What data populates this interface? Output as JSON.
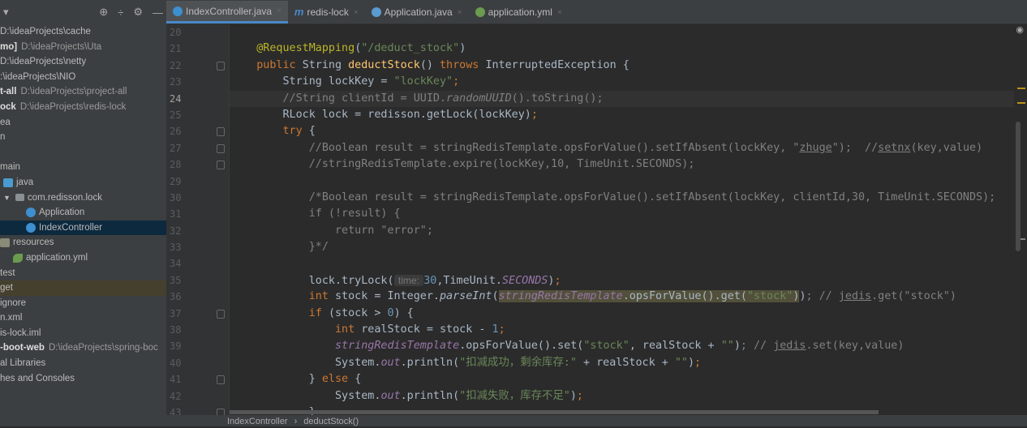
{
  "sidebar": {
    "header_icons": [
      "target-icon",
      "collapse-icon",
      "gear-icon",
      "minimize-icon"
    ],
    "items": [
      {
        "bold": "",
        "path": "D:\\ideaProjects\\cache",
        "icon": ""
      },
      {
        "bold": "mo]",
        "path": "D:\\ideaProjects\\Uta",
        "icon": ""
      },
      {
        "bold": "",
        "path": "D:\\ideaProjects\\netty",
        "icon": ""
      },
      {
        "bold": "",
        "path": ":\\ideaProjects\\NIO",
        "icon": ""
      },
      {
        "bold": "t-all",
        "path": "D:\\ideaProjects\\project-all",
        "icon": ""
      },
      {
        "bold": "ock",
        "path": "D:\\ideaProjects\\redis-lock",
        "icon": ""
      },
      {
        "bold": "",
        "path": "ea",
        "icon": ""
      },
      {
        "bold": "",
        "path": "n",
        "icon": ""
      },
      {
        "bold": "",
        "path": "",
        "icon": ""
      },
      {
        "bold": "",
        "path": "main",
        "icon": ""
      },
      {
        "bold": "",
        "path": "java",
        "icon": "folder",
        "indent": 4
      },
      {
        "bold": "",
        "path": "com.redisson.lock",
        "icon": "pkg",
        "indent": 4,
        "arrow": "▼"
      },
      {
        "bold": "",
        "path": "Application",
        "icon": "cls",
        "indent": 32
      },
      {
        "bold": "",
        "path": "IndexController",
        "icon": "cls",
        "indent": 32,
        "selected": true
      },
      {
        "bold": "",
        "path": "resources",
        "icon": "res",
        "indent": 0
      },
      {
        "bold": "",
        "path": "application.yml",
        "icon": "yml",
        "indent": 16
      },
      {
        "bold": "",
        "path": "test",
        "icon": ""
      },
      {
        "bold": "",
        "path": "get",
        "icon": "",
        "highlight": true
      },
      {
        "bold": "",
        "path": "ignore",
        "icon": ""
      },
      {
        "bold": "",
        "path": "n.xml",
        "icon": ""
      },
      {
        "bold": "",
        "path": "is-lock.iml",
        "icon": ""
      },
      {
        "bold": "-boot-web",
        "path": "D:\\ideaProjects\\spring-boc",
        "icon": ""
      },
      {
        "bold": "",
        "path": "al Libraries",
        "icon": ""
      },
      {
        "bold": "",
        "path": "hes and Consoles",
        "icon": ""
      }
    ]
  },
  "tabs": [
    {
      "label": "IndexController.java",
      "icon": "class-icon",
      "active": true
    },
    {
      "label": "redis-lock",
      "icon": "maven-icon"
    },
    {
      "label": "Application.java",
      "icon": "spring-boot-icon"
    },
    {
      "label": "application.yml",
      "icon": "yml-icon"
    }
  ],
  "editor": {
    "current_line": 24,
    "lines": [
      {
        "n": "20",
        "t": []
      },
      {
        "n": "21",
        "t": [
          [
            "    ",
            ""
          ],
          [
            "@RequestMapping",
            "ann"
          ],
          [
            "(",
            ""
          ],
          [
            "\"/deduct_stock\"",
            "str"
          ],
          [
            ")",
            ""
          ]
        ]
      },
      {
        "n": "22",
        "fold": true,
        "t": [
          [
            "    ",
            ""
          ],
          [
            "public ",
            "kw"
          ],
          [
            "String ",
            ""
          ],
          [
            "deductStock",
            "fn"
          ],
          [
            "() ",
            ""
          ],
          [
            "throws ",
            "kw"
          ],
          [
            "InterruptedException {",
            ""
          ]
        ]
      },
      {
        "n": "23",
        "t": [
          [
            "        String lockKey = ",
            ""
          ],
          [
            "\"lockKey\"",
            "str"
          ],
          [
            ";",
            "kw"
          ]
        ]
      },
      {
        "n": "24",
        "t": [
          [
            "        ",
            ""
          ],
          [
            "//String clientId = UUID.",
            "cm"
          ],
          [
            "randomUUID",
            "cm it"
          ],
          [
            "().toString();",
            "cm"
          ]
        ]
      },
      {
        "n": "25",
        "t": [
          [
            "        RLock lock = redisson.getLock(lockKey)",
            ""
          ],
          [
            ";",
            "kw"
          ]
        ]
      },
      {
        "n": "26",
        "fold": true,
        "t": [
          [
            "        ",
            ""
          ],
          [
            "try ",
            "kw"
          ],
          [
            "{",
            ""
          ]
        ]
      },
      {
        "n": "27",
        "fold": true,
        "t": [
          [
            "            ",
            ""
          ],
          [
            "//Boolean result = stringRedisTemplate.opsForValue().setIfAbsent(lockKey, \"",
            "cm"
          ],
          [
            "zhuge",
            "cm ul"
          ],
          [
            "\");  //",
            "cm"
          ],
          [
            "setnx",
            "cm ul"
          ],
          [
            "(key,value)",
            "cm"
          ]
        ]
      },
      {
        "n": "28",
        "fold": true,
        "t": [
          [
            "            ",
            ""
          ],
          [
            "//stringRedisTemplate.expire(lockKey,10, TimeUnit.SECONDS);",
            "cm"
          ]
        ]
      },
      {
        "n": "29",
        "t": []
      },
      {
        "n": "30",
        "t": [
          [
            "            ",
            ""
          ],
          [
            "/*Boolean result = stringRedisTemplate.opsForValue().setIfAbsent(lockKey, clientId,30, TimeUnit.SECONDS);",
            "cm"
          ]
        ]
      },
      {
        "n": "31",
        "t": [
          [
            "            ",
            ""
          ],
          [
            "if (!result) {",
            "cm"
          ]
        ]
      },
      {
        "n": "32",
        "t": [
          [
            "                ",
            ""
          ],
          [
            "return \"error\";",
            "cm"
          ]
        ]
      },
      {
        "n": "33",
        "t": [
          [
            "            ",
            ""
          ],
          [
            "}*/",
            "cm"
          ]
        ]
      },
      {
        "n": "34",
        "t": []
      },
      {
        "n": "35",
        "t": [
          [
            "            lock.tryLock(",
            ""
          ],
          [
            " time: ",
            "hint"
          ],
          [
            "30",
            "num"
          ],
          [
            ",TimeUnit.",
            ""
          ],
          [
            "SECONDS",
            "fld"
          ],
          [
            ")",
            ""
          ],
          [
            ";",
            "kw"
          ]
        ]
      },
      {
        "n": "36",
        "t": [
          [
            "            ",
            ""
          ],
          [
            "int ",
            "kw"
          ],
          [
            "stock = Integer.",
            ""
          ],
          [
            "parseInt",
            "it"
          ],
          [
            "(",
            ""
          ],
          [
            "stringRedisTemplate",
            "fld hlbg"
          ],
          [
            ".opsForValue().get(",
            "hlbg"
          ],
          [
            "\"stock\"",
            "str hlbg"
          ],
          [
            ")",
            "hlbg"
          ],
          [
            ")",
            ""
          ],
          [
            "; // ",
            "cm"
          ],
          [
            "jedis",
            "cm ul"
          ],
          [
            ".get(\"stock\")",
            "cm"
          ]
        ]
      },
      {
        "n": "37",
        "fold": true,
        "t": [
          [
            "            ",
            ""
          ],
          [
            "if ",
            "kw"
          ],
          [
            "(stock > ",
            ""
          ],
          [
            "0",
            "num"
          ],
          [
            ") {",
            ""
          ]
        ]
      },
      {
        "n": "38",
        "t": [
          [
            "                ",
            ""
          ],
          [
            "int ",
            "kw"
          ],
          [
            "realStock = stock - ",
            ""
          ],
          [
            "1",
            "num"
          ],
          [
            ";",
            "kw"
          ]
        ]
      },
      {
        "n": "39",
        "t": [
          [
            "                ",
            ""
          ],
          [
            "stringRedisTemplate",
            "fld"
          ],
          [
            ".opsForValue().set(",
            ""
          ],
          [
            "\"stock\"",
            "str"
          ],
          [
            ", realStock + ",
            ""
          ],
          [
            "\"\"",
            "str"
          ],
          [
            ")",
            ""
          ],
          [
            "; // ",
            "cm"
          ],
          [
            "jedis",
            "cm ul"
          ],
          [
            ".set(key,value)",
            "cm"
          ]
        ]
      },
      {
        "n": "40",
        "t": [
          [
            "                System.",
            ""
          ],
          [
            "out",
            "fld"
          ],
          [
            ".println(",
            ""
          ],
          [
            "\"扣减成功，剩余库存:\"",
            "str"
          ],
          [
            " + realStock + ",
            ""
          ],
          [
            "\"\"",
            "str"
          ],
          [
            ")",
            ""
          ],
          [
            ";",
            "kw"
          ]
        ]
      },
      {
        "n": "41",
        "fold": true,
        "t": [
          [
            "            } ",
            ""
          ],
          [
            "else ",
            "kw"
          ],
          [
            "{",
            ""
          ]
        ]
      },
      {
        "n": "42",
        "t": [
          [
            "                System.",
            ""
          ],
          [
            "out",
            "fld"
          ],
          [
            ".println(",
            ""
          ],
          [
            "\"扣减失败，库存不足\"",
            "str"
          ],
          [
            ")",
            ""
          ],
          [
            ";",
            "kw"
          ]
        ]
      },
      {
        "n": "43",
        "fold": true,
        "t": [
          [
            "            }",
            ""
          ]
        ]
      }
    ]
  },
  "breadcrumb": [
    "IndexController",
    "deductStock()"
  ]
}
